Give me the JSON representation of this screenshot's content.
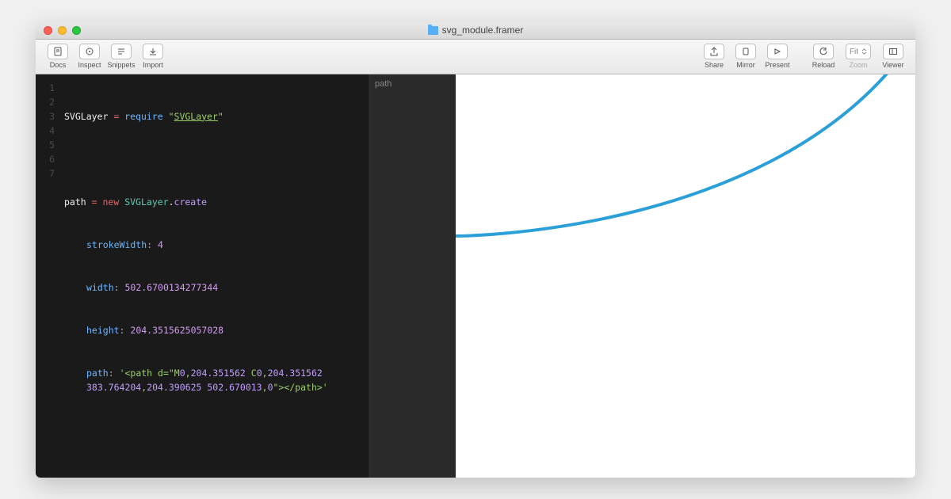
{
  "window": {
    "title": "svg_module.framer"
  },
  "toolbar": {
    "docs": "Docs",
    "inspect": "Inspect",
    "snippets": "Snippets",
    "import": "Import",
    "share": "Share",
    "mirror": "Mirror",
    "present": "Present",
    "reload": "Reload",
    "zoom_label": "Zoom",
    "zoom_value": "Fit",
    "viewer": "Viewer"
  },
  "layers": {
    "item0": "path"
  },
  "code": {
    "l1_a": "SVGLayer",
    "l1_eq": " = ",
    "l1_req": "require",
    "l1_sp": " ",
    "l1_q1": "\"",
    "l1_str": "SVGLayer",
    "l1_q2": "\"",
    "l3_a": "path",
    "l3_eq": " = ",
    "l3_new": "new",
    "l3_sp": " ",
    "l3_cls": "SVGLayer",
    "l3_dot": ".",
    "l3_m": "create",
    "l4_p": "strokeWidth",
    "l4_c": ": ",
    "l4_v": "4",
    "l5_p": "width",
    "l5_c": ": ",
    "l5_v": "502.6700134277344",
    "l6_p": "height",
    "l6_c": ": ",
    "l6_v": "204.3515625057028",
    "l7_p": "path",
    "l7_c": ": ",
    "l7_s1": "'<path d=\"M",
    "l7_n1": "0",
    "l7_s2": ",",
    "l7_n2": "204.351562",
    "l7_s3": " C",
    "l7_n3": "0",
    "l7_s4": ",",
    "l7_n4": "204.351562",
    "l7_s4b": " ",
    "l7_n5": "383.764204",
    "l7_s5": ",",
    "l7_n6": "204.390625",
    "l7_s5b": " ",
    "l7_n7": "502.670013",
    "l7_s6": ",",
    "l7_n8": "0",
    "l7_s7": "\"></path>'"
  },
  "gutter": {
    "n1": "1",
    "n2": "2",
    "n3": "3",
    "n4": "4",
    "n5": "5",
    "n6": "6",
    "n7": "7"
  }
}
